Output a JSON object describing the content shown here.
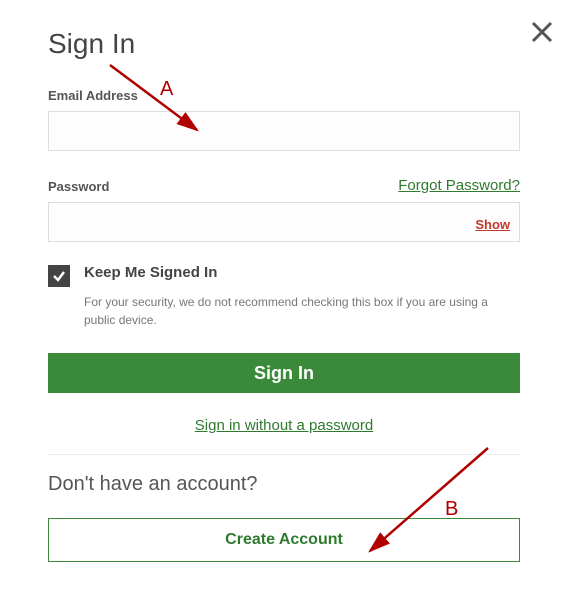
{
  "title": "Sign In",
  "email": {
    "label": "Email Address",
    "value": ""
  },
  "password": {
    "label": "Password",
    "value": "",
    "forgot_label": "Forgot Password?",
    "show_label": "Show"
  },
  "keep_signed": {
    "checked": true,
    "label": "Keep Me Signed In",
    "note": "For your security, we do not recommend checking this box if you are using a public device."
  },
  "signin_button": "Sign In",
  "passwordless_link": "Sign in without a password",
  "no_account_heading": "Don't have an account?",
  "create_account_button": "Create Account",
  "annotations": {
    "a": "A",
    "b": "B"
  }
}
